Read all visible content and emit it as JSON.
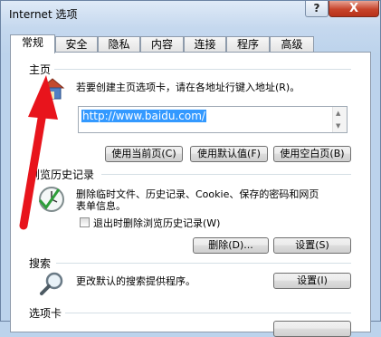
{
  "window": {
    "title": "Internet 选项",
    "help_label": "?",
    "close_label": "X"
  },
  "tabs": [
    {
      "label": "常规",
      "active": true
    },
    {
      "label": "安全"
    },
    {
      "label": "隐私"
    },
    {
      "label": "内容"
    },
    {
      "label": "连接"
    },
    {
      "label": "程序"
    },
    {
      "label": "高级"
    }
  ],
  "homepage": {
    "section_label": "主页",
    "description": "若要创建主页选项卡，请在各地址行键入地址(R)。",
    "url_value": "http://www.baidu.com/",
    "use_current_label": "使用当前页(C)",
    "use_default_label": "使用默认值(F)",
    "use_blank_label": "使用空白页(B)",
    "icon": "home-icon"
  },
  "history": {
    "section_label": "浏览历史记录",
    "description_line1": "删除临时文件、历史记录、Cookie、保存的密码和网页",
    "description_line2": "表单信息。",
    "checkbox_label": "退出时删除浏览历史记录(W)",
    "checkbox_checked": false,
    "delete_label": "删除(D)...",
    "settings_label": "设置(S)",
    "icon": "history-clock-icon"
  },
  "search": {
    "section_label": "搜索",
    "description": "更改默认的搜索提供程序。",
    "settings_label": "设置(I)",
    "icon": "magnifier-icon"
  },
  "tabs_section": {
    "section_label": "选项卡"
  },
  "colors": {
    "annotation_arrow": "#e8141c",
    "selection": "#3399ff"
  }
}
